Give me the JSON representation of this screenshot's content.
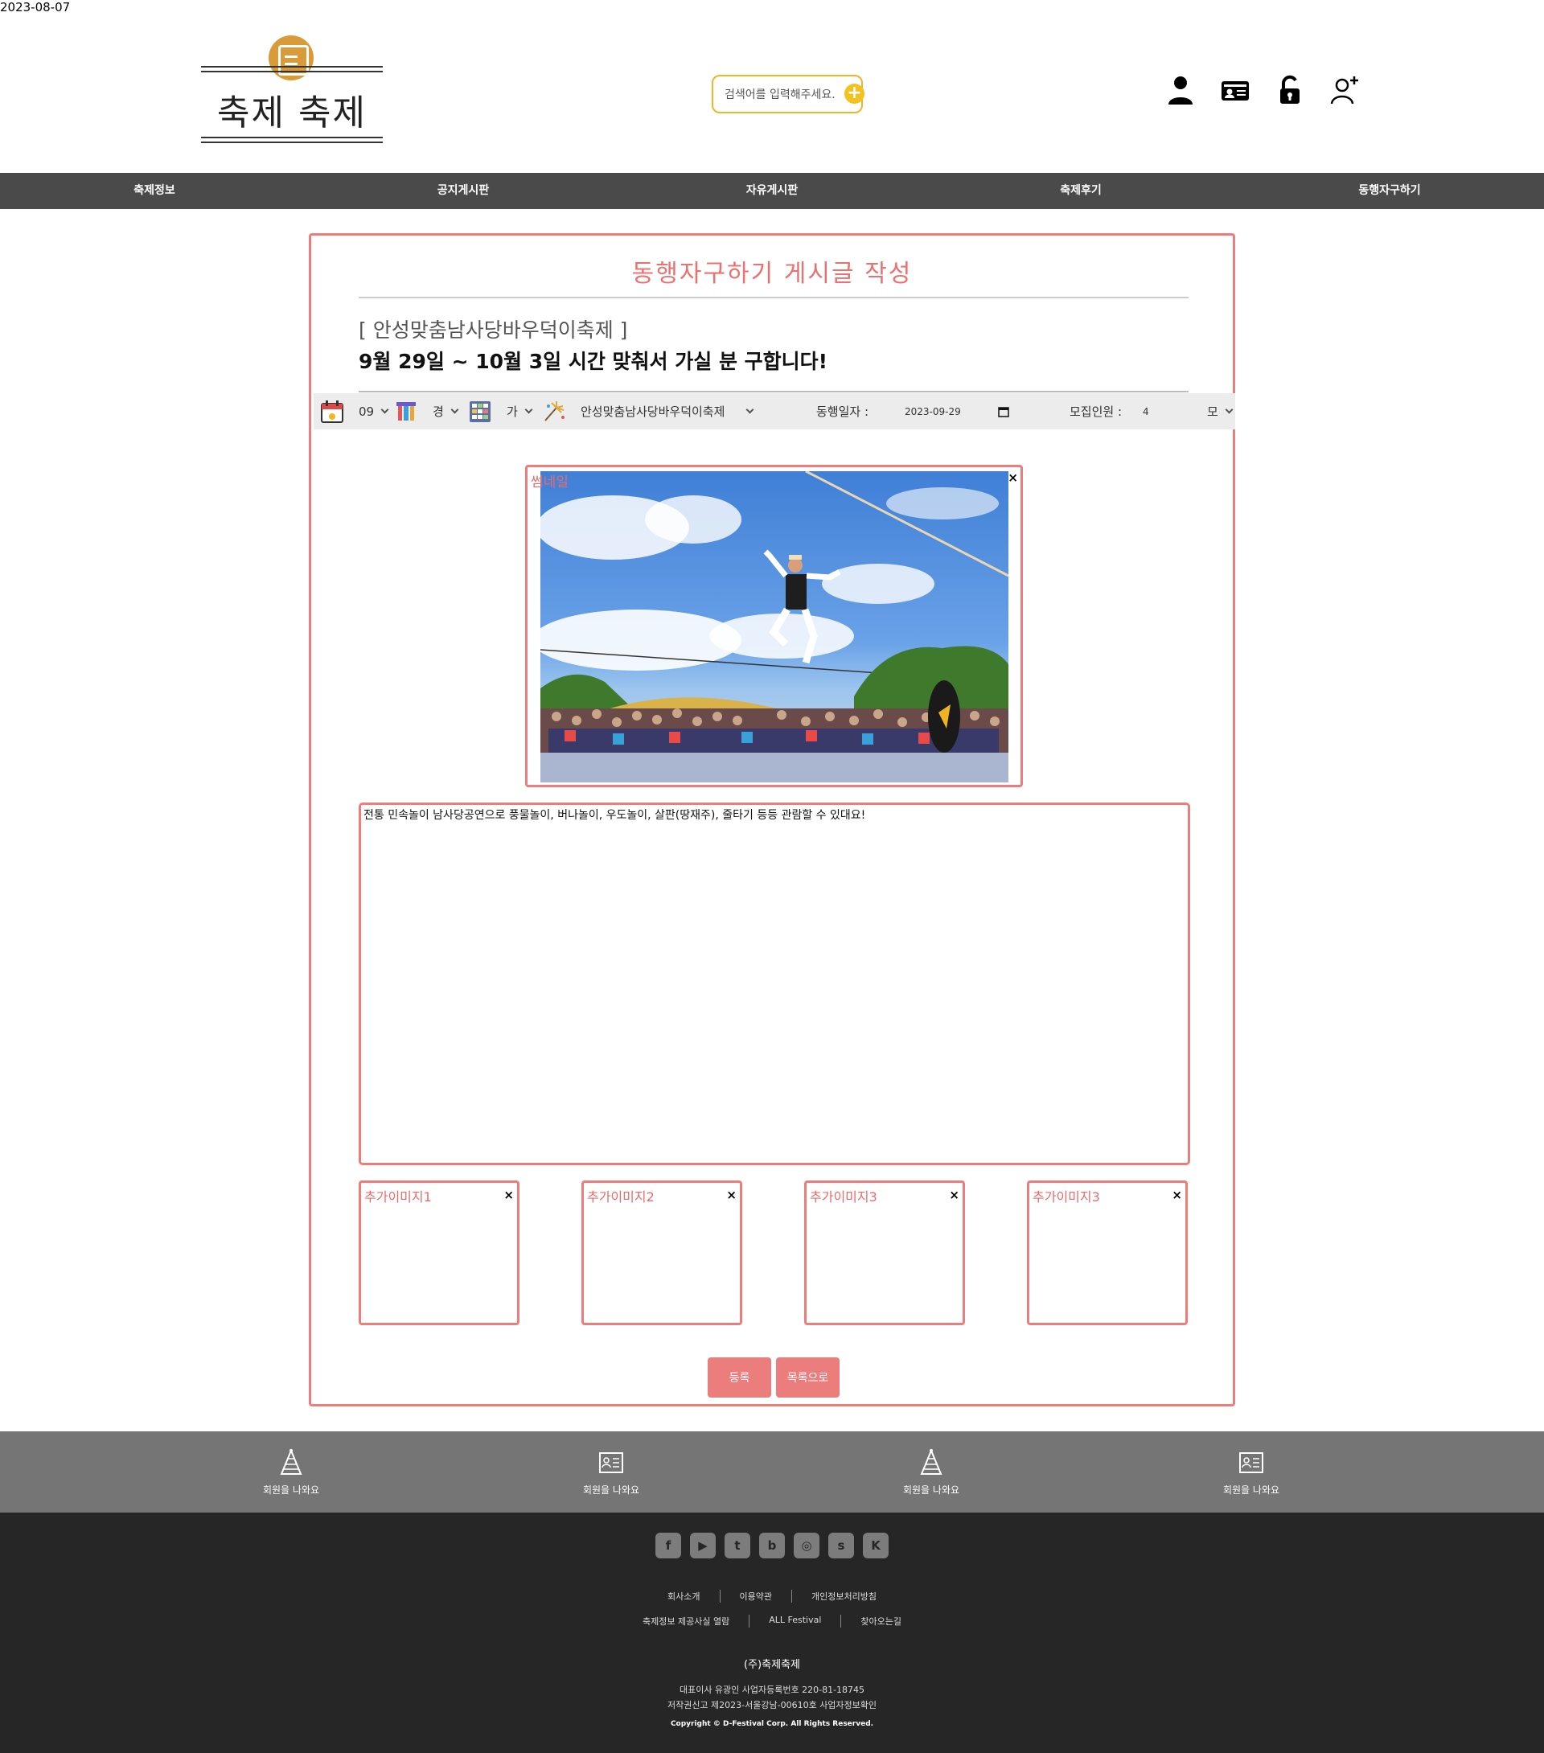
{
  "date_stamp": "2023-08-07",
  "header": {
    "logo_text": "축제 축제",
    "search_placeholder": "검색어를 입력해주세요.",
    "icons": [
      "user-icon",
      "id-card-icon",
      "unlock-icon",
      "add-user-icon"
    ]
  },
  "nav": {
    "items": [
      "축제정보",
      "공지게시판",
      "자유게시판",
      "축제후기",
      "동행자구하기"
    ]
  },
  "form": {
    "title": "동행자구하기 게시글 작성",
    "festival_label": "[ 안성맞춤남사당바우덕이축제 ]",
    "post_title": "9월 29일 ~ 10월 3일 시간 맞춰서 가실 분 구합니다!",
    "toolbar": {
      "month_value": "09",
      "region_value": "경",
      "category_value": "가",
      "festival_value": "안성맞춤남사당바우덕이축제",
      "date_label": "동행일자 :",
      "date_value": "2023-09-29",
      "people_label": "모집인원 :",
      "people_value": "4",
      "last_select_value": "모"
    },
    "thumbnail_label": "썸네일",
    "close_symbol": "×",
    "content_text": "전통 민속놀이 남사당공연으로 풍물놀이, 버나놀이, 우도놀이, 살판(땅재주), 줄타기 등등 관람할 수 있대요!",
    "extra_images": [
      "추가이미지1",
      "추가이미지2",
      "추가이미지3",
      "추가이미지3"
    ],
    "submit_label": "등록",
    "list_label": "목록으로"
  },
  "footer": {
    "top_items": [
      {
        "icon": "party-hat-icon",
        "label": "회원을 나와요"
      },
      {
        "icon": "id-card-icon",
        "label": "회원을 나와요"
      },
      {
        "icon": "party-hat-icon",
        "label": "회원을 나와요"
      },
      {
        "icon": "id-card-icon",
        "label": "회원을 나와요"
      }
    ],
    "socials": [
      {
        "icon": "facebook-icon",
        "glyph": "f"
      },
      {
        "icon": "youtube-icon",
        "glyph": "▶"
      },
      {
        "icon": "twitter-icon",
        "glyph": "t"
      },
      {
        "icon": "blog-icon",
        "glyph": "b"
      },
      {
        "icon": "instagram-icon",
        "glyph": "◎"
      },
      {
        "icon": "kakao-story-icon",
        "glyph": "s"
      },
      {
        "icon": "kakao-channel-icon",
        "glyph": "K"
      }
    ],
    "links_row1": [
      "회사소개",
      "이용약관",
      "개인정보처리방침"
    ],
    "links_row2": [
      "축제정보 제공사실 열람",
      "ALL Festival",
      "찾아오는길"
    ],
    "company": "(주)축제축제",
    "info_line1": "대표이사 유광인 사업자등록번호 220-81-18745",
    "info_line2": "저작권신고 제2023-서울강남-00610호 사업자정보확인",
    "copyright": "Copyright © D-Festival Corp. All Rights Reserved."
  },
  "colors": {
    "accent": "#ec7d7d",
    "nav_bg": "#4a4a4a",
    "footer_top_bg": "#757575",
    "footer_bottom_bg": "#262626",
    "search_border": "#f1b526"
  }
}
